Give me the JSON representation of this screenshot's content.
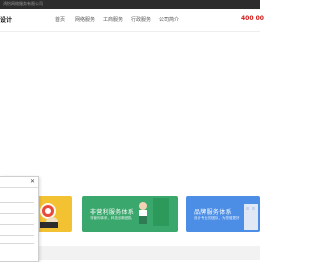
{
  "topbar": {
    "text": "鸿怡网络服务有限公司"
  },
  "header": {
    "logo_text": "设计"
  },
  "nav": {
    "items": [
      {
        "label": "首页"
      },
      {
        "label": "网络服务"
      },
      {
        "label": "工商服务"
      },
      {
        "label": "行政服务"
      },
      {
        "label": "公司简介"
      }
    ]
  },
  "phone": "400 00",
  "services": [
    {
      "title": "",
      "sub": ""
    },
    {
      "title": "非营利服务体系",
      "sub": "非营利体系，科技创新团队"
    },
    {
      "title": "品牌服务体系",
      "sub": "设计专业的团队，为您做更好"
    }
  ],
  "popup": {
    "close_label": "✕"
  },
  "colors": {
    "topbar": "#2d2d2d",
    "phone": "#d31b1b",
    "service_yellow": "#f3c233",
    "service_green": "#3aa76c",
    "service_blue": "#4c8ee6"
  }
}
